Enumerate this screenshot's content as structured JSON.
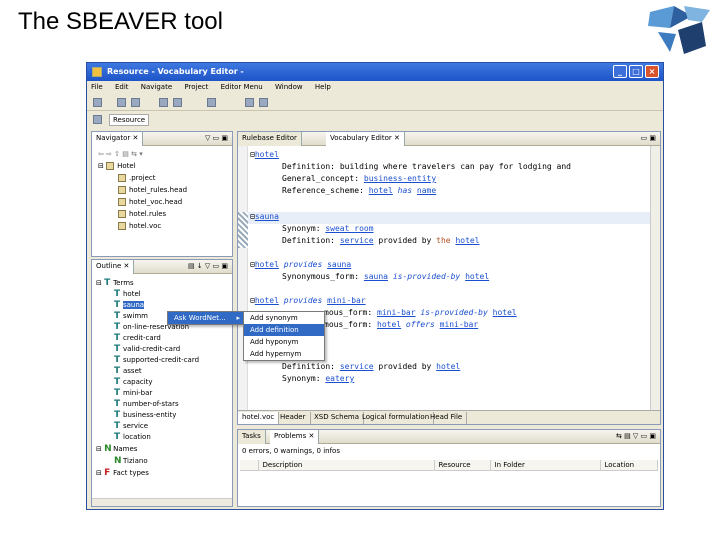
{
  "slide": {
    "title": "The SBEAVER tool"
  },
  "window": {
    "title": "Resource - Vocabulary Editor -"
  },
  "menubar": [
    "File",
    "Edit",
    "Navigate",
    "Project",
    "Editor Menu",
    "Window",
    "Help"
  ],
  "perspective": {
    "label": "Resource"
  },
  "navigator": {
    "tab": "Navigator",
    "root": "Hotel",
    "files": [
      ".project",
      "hotel_rules.head",
      "hotel_voc.head",
      "hotel.rules",
      "hotel.voc"
    ]
  },
  "outline": {
    "tab": "Outline",
    "terms_label": "Terms",
    "terms": [
      "hotel",
      "sauna",
      "swimm",
      "on-line-reservation",
      "credit-card",
      "valid-credit-card",
      "supported-credit-card",
      "asset",
      "capacity",
      "mini-bar",
      "number-of-stars",
      "business-entity",
      "service",
      "location"
    ],
    "names_label": "Names",
    "names": [
      "Tiziano"
    ],
    "facts_label": "Fact types"
  },
  "context_menu": {
    "item": "Ask WordNet...",
    "submenu": [
      "Add synonym",
      "Add definition",
      "Add hyponym",
      "Add hypernym"
    ]
  },
  "editor": {
    "tabs": [
      "Rulebase Editor",
      "Vocabulary Editor"
    ],
    "bottom_tabs": [
      "hotel.voc",
      "Header",
      "XSD Schema",
      "Logical formulation",
      "Head File"
    ],
    "lines": {
      "hotel": "hotel",
      "def_label": "Definition:",
      "def_text": "building where travelers can pay for lodging and",
      "gc_label": "General_concept:",
      "gc_val": "business-entity",
      "rs_label": "Reference_scheme:",
      "rs_hotel": "hotel",
      "rs_has": "has",
      "rs_name": "name",
      "sauna": "sauna",
      "syn_label": "Synonym:",
      "syn_val": "sweat_room",
      "def2_service": "service",
      "def2_text": "provided by",
      "def2_the": "the",
      "def2_hotel": "hotel",
      "hp_hotel": "hotel",
      "hp_provides": "provides",
      "hp_sauna": "sauna",
      "sf_label": "Synonymous_form:",
      "sf_sauna": "sauna",
      "sf_rel": "is-provided-by",
      "sf_hotel": "hotel",
      "hm_prefix": "hotel",
      "hm_provides": "provides",
      "hm_minibar": "mini-bar",
      "sf2_frag": "mous_form:",
      "sf2_minibar": "mini-bar",
      "sf2_rel": "is-provided-by",
      "sf2_hotel": "hotel",
      "sf3_frag": "mous_form:",
      "sf3_hotel": "hotel",
      "sf3_offers": "offers",
      "sf3_minibar": "mini-bar",
      "def4_label": "Definition:",
      "def4_service": "service",
      "def4_text": "provided by",
      "def4_hotel": "hotel",
      "syn4_label": "Synonym:",
      "syn4_val": "eatery"
    }
  },
  "problems": {
    "tabs": [
      "Tasks",
      "Problems"
    ],
    "summary": "0 errors, 0 warnings, 0 infos",
    "columns": [
      "Description",
      "Resource",
      "In Folder",
      "Location"
    ]
  }
}
